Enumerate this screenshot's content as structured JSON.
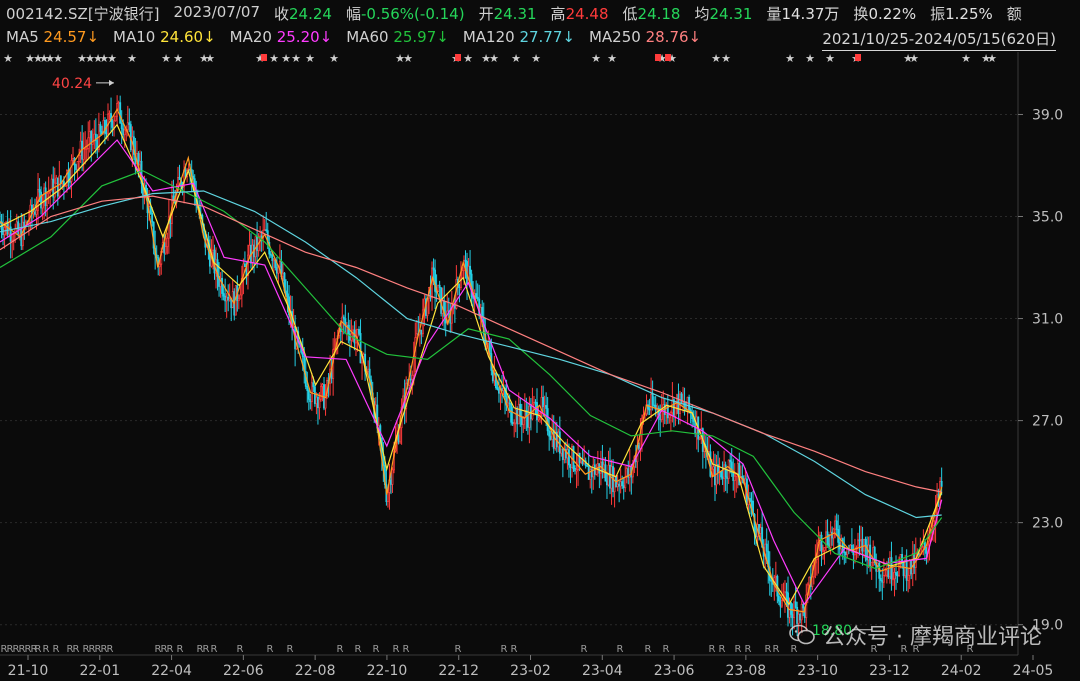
{
  "header": {
    "code": "002142.SZ[宁波银行]",
    "date": "2023/07/07",
    "close_label": "收",
    "close": "24.24",
    "change_label": "幅",
    "change": "-0.56%(-0.14)",
    "open_label": "开",
    "open": "24.31",
    "high_label": "高",
    "high": "24.48",
    "low_label": "低",
    "low": "24.18",
    "avg_label": "均",
    "avg": "24.31",
    "volume_label": "量",
    "volume": "14.37万",
    "turnover_label": "换",
    "turnover": "0.22%",
    "amplitude_label": "振",
    "amplitude": "1.25%",
    "amount_label": "额"
  },
  "ma": [
    {
      "name": "MA5",
      "value": "24.57↓",
      "color": "#ff9a1f"
    },
    {
      "name": "MA10",
      "value": "24.60↓",
      "color": "#ffe43a"
    },
    {
      "name": "MA20",
      "value": "25.20↓",
      "color": "#ff3cff"
    },
    {
      "name": "MA60",
      "value": "25.97↓",
      "color": "#22c23c"
    },
    {
      "name": "MA120",
      "value": "27.77↓",
      "color": "#5fd5e0"
    },
    {
      "name": "MA250",
      "value": "28.76↓",
      "color": "#ff8080"
    }
  ],
  "range": "2021/10/25-2024/05/15(620日)",
  "watermark": "公众号 · 摩羯商业评论",
  "colors": {
    "up": "#ff3b3b",
    "down": "#25d0e6",
    "grid": "#2a2a2a"
  },
  "chart_data": {
    "type": "line",
    "x_ticks": [
      "21-10",
      "22-01",
      "22-04",
      "22-06",
      "22-08",
      "22-10",
      "22-12",
      "23-02",
      "23-04",
      "23-06",
      "23-08",
      "23-10",
      "23-12",
      "24-02",
      "24-05"
    ],
    "y_ticks": [
      19.0,
      23.0,
      27.0,
      31.0,
      35.0,
      39.0
    ],
    "ylim": [
      18.4,
      40.9
    ],
    "annotations": [
      {
        "text": "40.24",
        "x": "22-01",
        "y": 40.24
      },
      {
        "text": "18.80",
        "x": "23-12",
        "y": 18.8
      }
    ],
    "series": [
      {
        "values": [
          [
            0,
            34.8
          ],
          [
            0.02,
            34.2
          ],
          [
            0.04,
            35.8
          ],
          [
            0.06,
            36.3
          ],
          [
            0.08,
            37.6
          ],
          [
            0.1,
            38.2
          ],
          [
            0.115,
            39.2
          ],
          [
            0.13,
            37.9
          ],
          [
            0.145,
            35.5
          ],
          [
            0.155,
            33.0
          ],
          [
            0.17,
            35.5
          ],
          [
            0.185,
            37.3
          ],
          [
            0.2,
            34.2
          ],
          [
            0.215,
            32.6
          ],
          [
            0.23,
            31.6
          ],
          [
            0.245,
            33.4
          ],
          [
            0.26,
            34.3
          ],
          [
            0.275,
            32.9
          ],
          [
            0.29,
            30.2
          ],
          [
            0.305,
            28.1
          ],
          [
            0.32,
            27.9
          ],
          [
            0.335,
            30.9
          ],
          [
            0.35,
            30.3
          ],
          [
            0.365,
            28.3
          ],
          [
            0.38,
            24.1
          ],
          [
            0.395,
            27.4
          ],
          [
            0.41,
            30.2
          ],
          [
            0.425,
            32.6
          ],
          [
            0.44,
            30.8
          ],
          [
            0.455,
            33.2
          ],
          [
            0.47,
            31.4
          ],
          [
            0.485,
            28.9
          ],
          [
            0.5,
            27.4
          ],
          [
            0.515,
            27.1
          ],
          [
            0.53,
            27.6
          ],
          [
            0.545,
            26.3
          ],
          [
            0.56,
            25.6
          ],
          [
            0.575,
            24.9
          ],
          [
            0.59,
            25.2
          ],
          [
            0.605,
            24.6
          ],
          [
            0.62,
            24.9
          ],
          [
            0.635,
            27.6
          ],
          [
            0.65,
            27.4
          ],
          [
            0.665,
            27.7
          ],
          [
            0.68,
            27.3
          ],
          [
            0.69,
            26.3
          ],
          [
            0.7,
            24.8
          ],
          [
            0.715,
            25.2
          ],
          [
            0.73,
            24.7
          ],
          [
            0.745,
            22.6
          ],
          [
            0.76,
            20.6
          ],
          [
            0.775,
            19.6
          ],
          [
            0.79,
            19.5
          ],
          [
            0.805,
            22.3
          ],
          [
            0.82,
            22.6
          ],
          [
            0.835,
            21.9
          ],
          [
            0.85,
            22.1
          ],
          [
            0.865,
            21.1
          ],
          [
            0.88,
            21.3
          ],
          [
            0.895,
            21.2
          ],
          [
            0.91,
            22.1
          ],
          [
            0.925,
            24.4
          ]
        ]
      },
      {
        "values": [
          [
            0,
            34.6
          ],
          [
            0.03,
            35.2
          ],
          [
            0.06,
            36.1
          ],
          [
            0.09,
            37.4
          ],
          [
            0.115,
            38.6
          ],
          [
            0.14,
            36.3
          ],
          [
            0.16,
            34.2
          ],
          [
            0.185,
            36.8
          ],
          [
            0.21,
            33.2
          ],
          [
            0.235,
            32.3
          ],
          [
            0.26,
            33.6
          ],
          [
            0.285,
            31.3
          ],
          [
            0.31,
            28.4
          ],
          [
            0.335,
            30.1
          ],
          [
            0.355,
            29.7
          ],
          [
            0.38,
            25.1
          ],
          [
            0.405,
            28.4
          ],
          [
            0.43,
            31.6
          ],
          [
            0.455,
            32.6
          ],
          [
            0.48,
            29.5
          ],
          [
            0.505,
            27.5
          ],
          [
            0.53,
            27.2
          ],
          [
            0.555,
            26.1
          ],
          [
            0.58,
            25.2
          ],
          [
            0.605,
            24.8
          ],
          [
            0.63,
            26.9
          ],
          [
            0.655,
            27.6
          ],
          [
            0.68,
            27.3
          ],
          [
            0.7,
            25.3
          ],
          [
            0.725,
            24.9
          ],
          [
            0.75,
            21.3
          ],
          [
            0.775,
            19.8
          ],
          [
            0.8,
            21.6
          ],
          [
            0.825,
            22.1
          ],
          [
            0.85,
            21.7
          ],
          [
            0.875,
            21.3
          ],
          [
            0.9,
            21.6
          ],
          [
            0.925,
            24.2
          ]
        ]
      },
      {
        "values": [
          [
            0,
            34.0
          ],
          [
            0.04,
            35.0
          ],
          [
            0.08,
            36.6
          ],
          [
            0.115,
            38.0
          ],
          [
            0.15,
            36.0
          ],
          [
            0.19,
            36.3
          ],
          [
            0.22,
            33.4
          ],
          [
            0.26,
            33.1
          ],
          [
            0.3,
            29.5
          ],
          [
            0.34,
            29.4
          ],
          [
            0.38,
            26.0
          ],
          [
            0.42,
            30.0
          ],
          [
            0.46,
            32.4
          ],
          [
            0.5,
            28.2
          ],
          [
            0.54,
            27.1
          ],
          [
            0.58,
            25.6
          ],
          [
            0.62,
            25.2
          ],
          [
            0.65,
            27.4
          ],
          [
            0.69,
            26.6
          ],
          [
            0.73,
            25.3
          ],
          [
            0.76,
            22.3
          ],
          [
            0.79,
            19.8
          ],
          [
            0.83,
            22.0
          ],
          [
            0.87,
            21.4
          ],
          [
            0.91,
            21.6
          ],
          [
            0.925,
            23.9
          ]
        ]
      },
      {
        "values": [
          [
            0,
            33.0
          ],
          [
            0.05,
            34.2
          ],
          [
            0.1,
            36.2
          ],
          [
            0.14,
            36.8
          ],
          [
            0.18,
            36.0
          ],
          [
            0.22,
            35.2
          ],
          [
            0.26,
            34.0
          ],
          [
            0.3,
            32.2
          ],
          [
            0.34,
            30.4
          ],
          [
            0.38,
            29.6
          ],
          [
            0.42,
            29.4
          ],
          [
            0.46,
            30.6
          ],
          [
            0.5,
            30.2
          ],
          [
            0.54,
            28.8
          ],
          [
            0.58,
            27.2
          ],
          [
            0.62,
            26.4
          ],
          [
            0.66,
            26.6
          ],
          [
            0.7,
            26.4
          ],
          [
            0.74,
            25.6
          ],
          [
            0.78,
            23.4
          ],
          [
            0.82,
            21.8
          ],
          [
            0.86,
            21.2
          ],
          [
            0.9,
            21.8
          ],
          [
            0.925,
            23.2
          ]
        ]
      },
      {
        "values": [
          [
            0,
            34.4
          ],
          [
            0.05,
            34.8
          ],
          [
            0.1,
            35.4
          ],
          [
            0.15,
            35.9
          ],
          [
            0.2,
            36.0
          ],
          [
            0.25,
            35.2
          ],
          [
            0.3,
            34.0
          ],
          [
            0.35,
            32.6
          ],
          [
            0.4,
            31.0
          ],
          [
            0.45,
            30.4
          ],
          [
            0.5,
            29.9
          ],
          [
            0.55,
            29.4
          ],
          [
            0.6,
            28.8
          ],
          [
            0.65,
            27.9
          ],
          [
            0.7,
            27.3
          ],
          [
            0.75,
            26.5
          ],
          [
            0.8,
            25.4
          ],
          [
            0.85,
            24.1
          ],
          [
            0.9,
            23.2
          ],
          [
            0.925,
            23.3
          ]
        ]
      },
      {
        "values": [
          [
            0,
            33.7
          ],
          [
            0.05,
            35.0
          ],
          [
            0.1,
            35.6
          ],
          [
            0.15,
            35.8
          ],
          [
            0.2,
            35.4
          ],
          [
            0.25,
            34.5
          ],
          [
            0.3,
            33.6
          ],
          [
            0.35,
            33.0
          ],
          [
            0.4,
            32.2
          ],
          [
            0.45,
            31.5
          ],
          [
            0.5,
            30.6
          ],
          [
            0.55,
            29.7
          ],
          [
            0.6,
            28.8
          ],
          [
            0.65,
            28.1
          ],
          [
            0.7,
            27.3
          ],
          [
            0.75,
            26.5
          ],
          [
            0.8,
            25.8
          ],
          [
            0.85,
            25.0
          ],
          [
            0.9,
            24.4
          ],
          [
            0.925,
            24.2
          ]
        ]
      }
    ]
  }
}
